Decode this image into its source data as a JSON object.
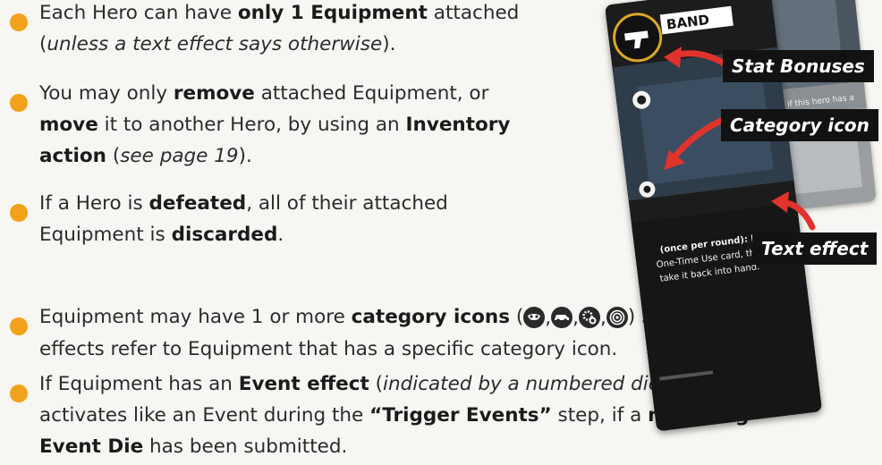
{
  "bullets": [
    {
      "lines": [
        [
          {
            "t": "Each Hero can have "
          },
          {
            "t": "only 1 Equipment",
            "b": true
          },
          {
            "t": " attached"
          }
        ],
        [
          {
            "t": "("
          },
          {
            "t": "unless a text effect says otherwise",
            "i": true
          },
          {
            "t": ")."
          }
        ]
      ]
    },
    {
      "lines": [
        [
          {
            "t": "You may only "
          },
          {
            "t": "remove",
            "b": true
          },
          {
            "t": " attached Equipment, or"
          }
        ],
        [
          {
            "t": "move",
            "b": true
          },
          {
            "t": " it to another Hero, by using an "
          },
          {
            "t": "Inventory",
            "b": true
          }
        ],
        [
          {
            "t": "action",
            "b": true
          },
          {
            "t": " ("
          },
          {
            "t": "see page 19",
            "i": true
          },
          {
            "t": ")."
          }
        ]
      ]
    },
    {
      "lines": [
        [
          {
            "t": "If a Hero is "
          },
          {
            "t": "defeated",
            "b": true
          },
          {
            "t": ", all of their attached"
          }
        ],
        [
          {
            "t": "Equipment is "
          },
          {
            "t": "discarded",
            "b": true
          },
          {
            "t": "."
          }
        ]
      ]
    },
    {
      "lines": [
        [
          {
            "t": "Equipment may have 1 or more "
          },
          {
            "t": "category icons",
            "b": true
          },
          {
            "t": " ("
          },
          {
            "icons": true
          },
          {
            "t": ") Some text"
          }
        ],
        [
          {
            "t": "effects refer to Equipment that has a specific category icon."
          }
        ]
      ]
    },
    {
      "lines": [
        [
          {
            "t": "If Equipment has an "
          },
          {
            "t": "Event effect",
            "b": true
          },
          {
            "t": " ("
          },
          {
            "t": "indicated by a numbered die face",
            "i": true
          },
          {
            "t": "), it"
          }
        ],
        [
          {
            "t": "activates like an Event during the "
          },
          {
            "t": "“Trigger Events”",
            "b": true
          },
          {
            "t": " step, if a "
          },
          {
            "t": "matching",
            "b": true
          }
        ],
        [
          {
            "t": "Event Die",
            "b": true
          },
          {
            "t": " has been submitted."
          }
        ]
      ]
    }
  ],
  "category_icons": [
    "mask-icon",
    "vehicle-icon",
    "gears-icon",
    "target-icon"
  ],
  "card": {
    "name_fragment": "BAND",
    "back_text": "On the last round, if this hero has a",
    "effect_text_1": "(once per round): Play a",
    "effect_text_2": "One-Time Use card, then",
    "effect_text_3": "take it back into hand."
  },
  "callouts": {
    "stat_bonuses": "Stat Bonuses",
    "category_icon": "Category icon",
    "text_effect": "Text effect"
  },
  "colors": {
    "bullet": "#f2a21a",
    "arrow": "#e0332b",
    "callout_bg": "#121212",
    "background": "#f7f6f2"
  }
}
